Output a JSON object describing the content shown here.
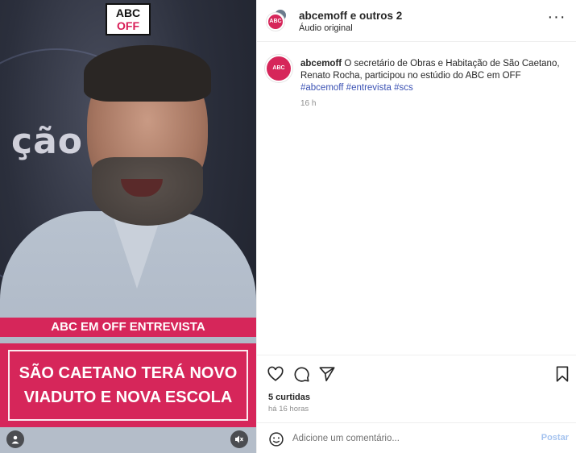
{
  "media": {
    "logo_text_top": "ABC",
    "logo_text_bottom": "OFF",
    "background_word": "ção",
    "band_label": "ABC EM OFF ENTREVISTA",
    "headline_line1": "SÃO CAETANO TERÁ NOVO",
    "headline_line2": "VIADUTO E NOVA ESCOLA",
    "accent_color": "#d6265a"
  },
  "header": {
    "username": "abcemoff e outros 2",
    "audio": "Áudio original",
    "more_icon": "more-horizontal-icon"
  },
  "caption": {
    "username": "abcemoff",
    "text": "O secretário de Obras e Habitação de São Caetano, Renato Rocha, participou no estúdio do ABC em OFF",
    "tags": "#abcemoff #entrevista #scs",
    "time": "16 h"
  },
  "actions": {
    "likes": "5 curtidas",
    "ago": "há 16 horas"
  },
  "comment": {
    "placeholder": "Adicione um comentário...",
    "post_label": "Postar"
  }
}
